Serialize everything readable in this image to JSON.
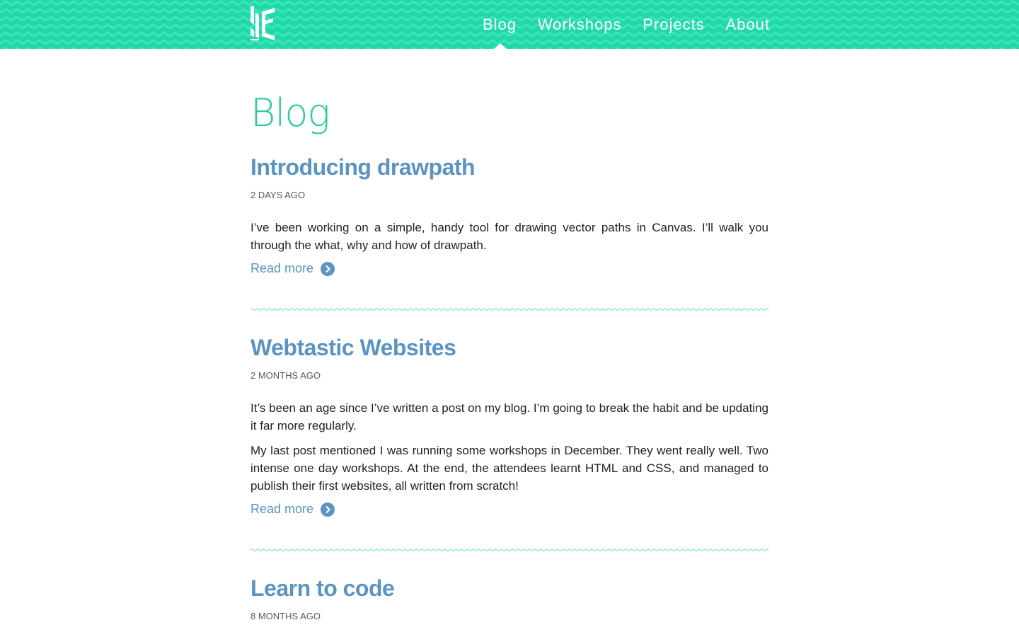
{
  "header": {
    "logo_icon": "je-monogram-logo-icon",
    "nav": [
      {
        "label": "Blog",
        "active": true
      },
      {
        "label": "Workshops"
      },
      {
        "label": "Projects"
      },
      {
        "label": "About"
      }
    ],
    "colors": {
      "header_bg": "#22d8a8",
      "pattern": "#35e4b7"
    }
  },
  "main": {
    "page_title": "Blog",
    "posts": [
      {
        "title": "Introducing drawpath",
        "date": "2 DAYS AGO",
        "paragraphs": [
          "I’ve been working on a simple, handy tool for drawing vector paths in Canvas. I’ll walk you through the what, why and how of drawpath."
        ],
        "read_more": "Read more"
      },
      {
        "title": "Webtastic Websites",
        "date": "2 MONTHS AGO",
        "paragraphs": [
          "It’s been an age since I’ve written a post on my blog. I’m going to break the habit and be updating it far more regularly.",
          "My last post mentioned I was running some workshops in December. They went really well. Two intense one day workshops. At the end, the attendees learnt HTML and CSS, and managed to publish their first websites, all written from scratch!"
        ],
        "read_more": "Read more"
      },
      {
        "title": "Learn to code",
        "date": "8 MONTHS AGO"
      }
    ],
    "colors": {
      "title": "#2fcb9a",
      "post_title": "#5b93c3",
      "link": "#5b93c3",
      "divider": "#8fe6cf"
    }
  }
}
